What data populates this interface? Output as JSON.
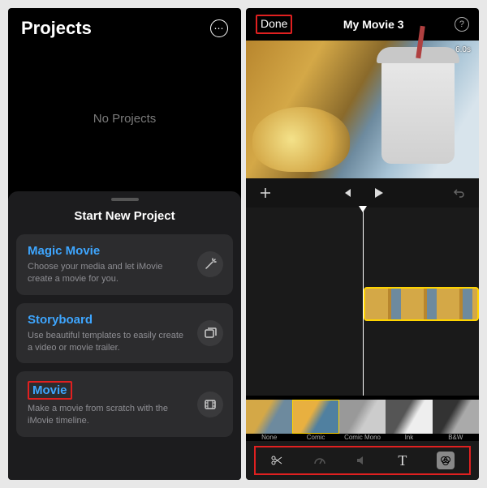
{
  "left": {
    "title": "Projects",
    "empty_text": "No Projects",
    "sheet_title": "Start New Project",
    "cards": [
      {
        "title": "Magic Movie",
        "desc": "Choose your media and let iMovie create a movie for you."
      },
      {
        "title": "Storyboard",
        "desc": "Use beautiful templates to easily create a video or movie trailer."
      },
      {
        "title": "Movie",
        "desc": "Make a movie from scratch with the iMovie timeline."
      }
    ]
  },
  "right": {
    "done": "Done",
    "title": "My Movie 3",
    "duration": "6.0s",
    "filters": [
      {
        "name": "None"
      },
      {
        "name": "Comic"
      },
      {
        "name": "Comic Mono"
      },
      {
        "name": "Ink"
      },
      {
        "name": "B&W"
      }
    ],
    "toolbar_text_label": "T"
  }
}
